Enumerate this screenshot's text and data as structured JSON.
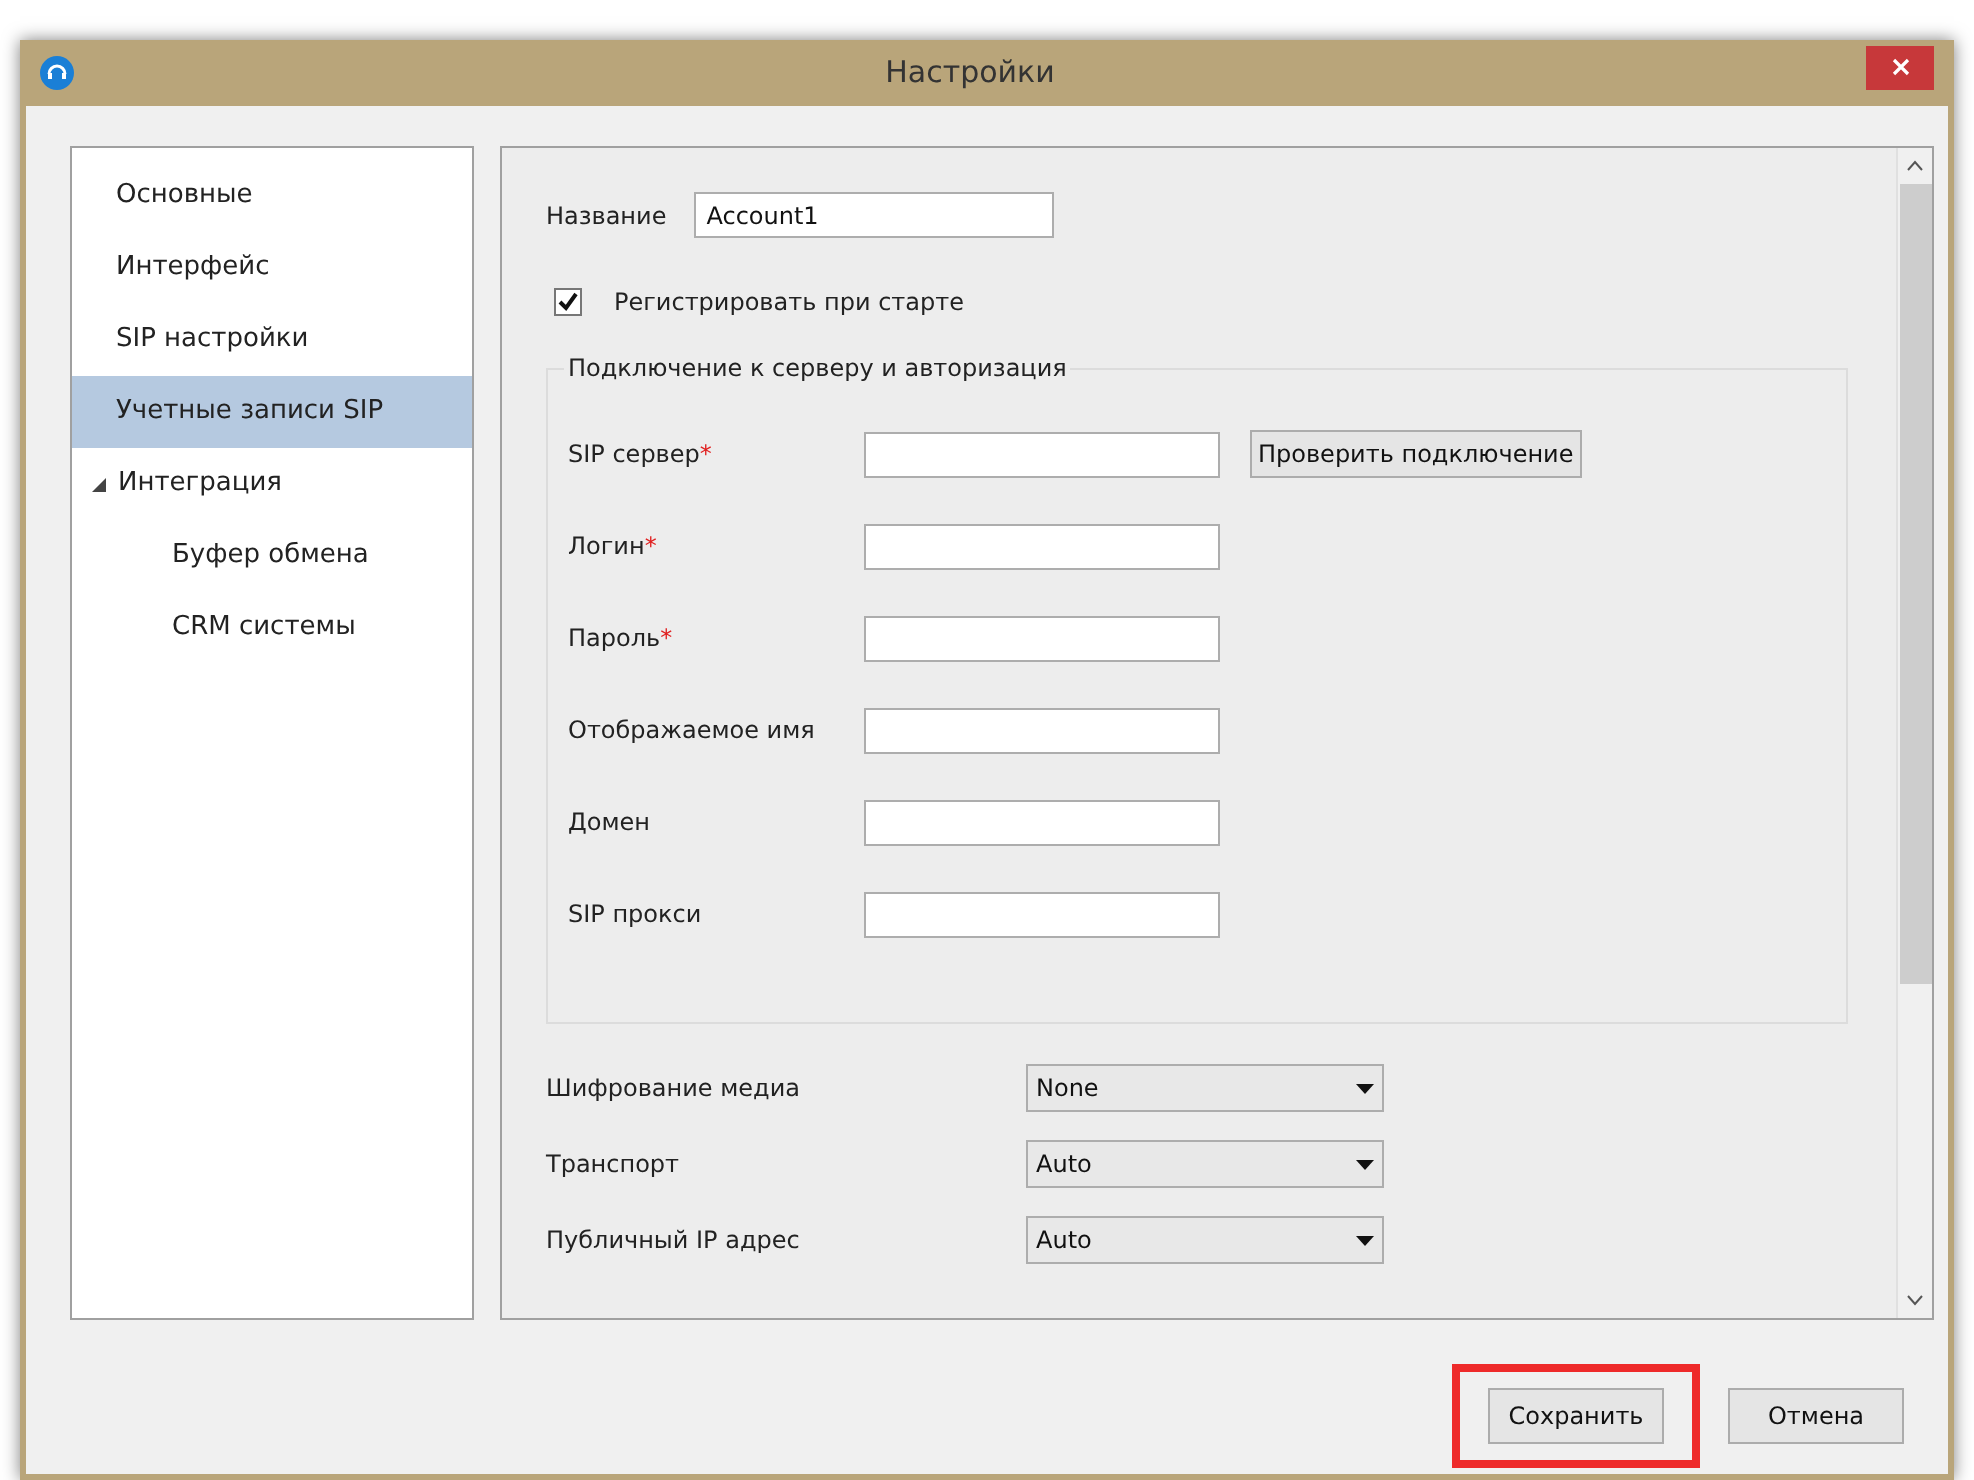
{
  "window": {
    "title": "Настройки"
  },
  "sidebar": {
    "items": [
      {
        "label": "Основные",
        "selected": false
      },
      {
        "label": "Интерфейс",
        "selected": false
      },
      {
        "label": "SIP настройки",
        "selected": false
      },
      {
        "label": "Учетные записи SIP",
        "selected": true
      },
      {
        "label": "Интеграция",
        "selected": false,
        "expanded": true,
        "children": [
          {
            "label": "Буфер обмена",
            "selected": false
          },
          {
            "label": "CRM системы",
            "selected": false
          }
        ]
      }
    ]
  },
  "account": {
    "name_label": "Название",
    "name_value": "Account1",
    "register_label": "Регистрировать при старте",
    "register_checked": true
  },
  "connection": {
    "title": "Подключение к серверу и авторизация",
    "fields": [
      {
        "label": "SIP сервер",
        "required": true
      },
      {
        "label": "Логин",
        "required": true
      },
      {
        "label": "Пароль",
        "required": true
      },
      {
        "label": "Отображаемое имя",
        "required": false
      },
      {
        "label": "Домен",
        "required": false
      },
      {
        "label": "SIP прокси",
        "required": false
      }
    ],
    "required_mark": "*",
    "check_button": "Проверить подключение"
  },
  "selects": [
    {
      "label": "Шифрование медиа",
      "value": "None"
    },
    {
      "label": "Транспорт",
      "value": "Auto"
    },
    {
      "label": "Публичный IP адрес",
      "value": "Auto"
    }
  ],
  "buttons": [
    {
      "label": "Сохранить",
      "highlighted": true
    },
    {
      "label": "Отмена",
      "highlighted": false
    }
  ]
}
